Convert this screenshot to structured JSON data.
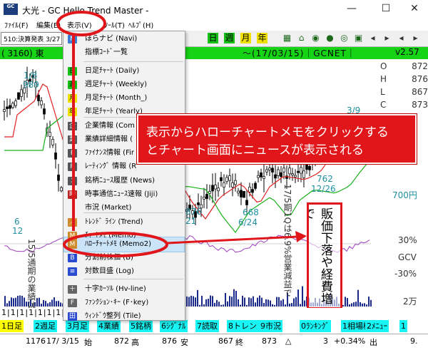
{
  "window": {
    "logo": "GC",
    "title": "大光 - GC Hello Trend Master -",
    "controls": {
      "minimize": "—",
      "maximize": "☐",
      "close": "✕"
    }
  },
  "menubar": {
    "file": "ﾌｧｲﾙ(F)",
    "edit": "編集(E)",
    "view": "表示(V)",
    "tool": "ﾂｰﾙ(T)",
    "help": "ﾍﾙﾌﾟ(H)"
  },
  "toolbar": {
    "info_text": "510:決算発表 3/27",
    "buttons": [
      "日",
      "週",
      "月",
      "年"
    ]
  },
  "chart": {
    "code_label": "( 3160) 東",
    "period_label": "～(17/03/15)｜GCNET｜",
    "version": "v2.57",
    "ohlc": [
      {
        "k": "O",
        "v": "872"
      },
      {
        "k": "H",
        "v": "876"
      },
      {
        "k": "L",
        "v": "867"
      },
      {
        "k": "C",
        "v": "873"
      }
    ],
    "labels": {
      "l1_date": "1/8",
      "l1_val": "989",
      "l2_val": "6",
      "l2_date": "12",
      "l3_val": "876",
      "l3_date": "21",
      "l4_val": "668",
      "l4_date": "6/24",
      "l5_val": "762",
      "l5_date": "12/26",
      "l6_date": "3/9",
      "price_700": "700円",
      "osc_30": "30%",
      "osc_gcv": "GCV",
      "osc_m30": "-30%",
      "vol_2m": "2万"
    },
    "vtext_left": "15/5通期の業績は",
    "vtext_mid": "17/5期1Qは6.9%営業減益で",
    "vtext_box": "販価下落や経費増で"
  },
  "bottom": {
    "tabs_row": "1|1|1|1|1|1|1|1|1|1|1|1|1|1|1|1",
    "funckeys": [
      {
        "label": "1日足",
        "style": "yellow"
      },
      {
        "label": "2週足",
        "style": "cyan-bg"
      },
      {
        "label": "3月足",
        "style": "cyan-bg"
      },
      {
        "label": "4業績",
        "style": "cyan-bg"
      },
      {
        "label": "5銘柄",
        "style": "cyan-bg"
      },
      {
        "label": "6ｼｸﾞﾅﾙ",
        "style": "cyan-bg"
      },
      {
        "label": "7読取",
        "style": "cyan-bg"
      },
      {
        "label": "8トレンド",
        "style": "cyan-bg"
      },
      {
        "label": "9市況",
        "style": "cyan-bg"
      },
      {
        "label": "0ﾗﾝｷﾝｸﾞ",
        "style": "cyan-bg"
      },
      {
        "label": "1相場欄",
        "style": "cyan-bg"
      },
      {
        "label": "2ﾒﾆｭｰ",
        "style": "cyan-bg"
      },
      {
        "label": "1",
        "style": "cyan-bg"
      }
    ],
    "status": {
      "s1": "1176",
      "s2": "17/ 3/15",
      "s3": "始",
      "s4": "872",
      "s5": "高",
      "s6": "876",
      "s7": "安",
      "s8": "867",
      "s9": "終",
      "s10": "873",
      "s11": "△",
      "s12": "3",
      "s13": "+0.34%",
      "s14": "出",
      "s15": "9."
    }
  },
  "dropdown": {
    "items": [
      {
        "label": "ほらナビ (Navi)",
        "icon": "navi-icon",
        "glyph": "N",
        "bg": "#3a7bd5",
        "fg": "#fff"
      },
      {
        "label": "指標ｺｰﾄﾞ一覧",
        "icon": "list-icon",
        "glyph": "",
        "bg": "transparent",
        "fg": "#000"
      },
      {
        "label": "日足ﾁｬｰﾄ (Daily)",
        "icon": "daily-chart-icon",
        "glyph": "日",
        "bg": "#17c117",
        "fg": "#000"
      },
      {
        "label": "週足ﾁｬｰﾄ (Weekly)",
        "icon": "weekly-chart-icon",
        "glyph": "週",
        "bg": "#17c117",
        "fg": "#000"
      },
      {
        "label": "月足ﾁｬｰﾄ (Month_)",
        "icon": "monthly-chart-icon",
        "glyph": "月",
        "bg": "#f0e000",
        "fg": "#000"
      },
      {
        "label": "年足ﾁｬｰﾄ (Yearly)",
        "icon": "yearly-chart-icon",
        "glyph": "年",
        "bg": "#f0e000",
        "fg": "#000"
      },
      {
        "label": "企業情報 (Com",
        "icon": "company-icon",
        "glyph": "企",
        "bg": "#555",
        "fg": "#fff"
      },
      {
        "label": "業績詳細情報 (",
        "icon": "earnings-icon",
        "glyph": "業",
        "bg": "#555",
        "fg": "#fff"
      },
      {
        "label": "ﾌｧｲﾅﾝｽ情報 (Fir",
        "icon": "finance-icon",
        "glyph": "F",
        "bg": "#555",
        "fg": "#fff"
      },
      {
        "label": "ﾚｰﾃｨﾝｸﾞ 情報 (R",
        "icon": "rating-icon",
        "glyph": "R",
        "bg": "#555",
        "fg": "#fff"
      },
      {
        "label": "銘柄ﾆｭｰｽ履歴 (News)",
        "icon": "news-icon",
        "glyph": "ﾆ",
        "bg": "#555",
        "fg": "#fff"
      },
      {
        "label": "時事通信ﾆｭｰｽ速報 (Jiji)",
        "icon": "jiji-icon",
        "glyph": "時",
        "bg": "#b22",
        "fg": "#fff"
      },
      {
        "label": "市況 (Market)",
        "icon": "market-icon",
        "glyph": "",
        "bg": "transparent",
        "fg": "#000"
      },
      {
        "label": "ﾄﾚﾝﾄﾞ ﾗｲﾝ (Trend)",
        "icon": "trend-icon",
        "glyph": "／",
        "bg": "#d08a2a",
        "fg": "#fff"
      },
      {
        "label": "ﾁｬｰﾄﾒﾓ (Memo)",
        "icon": "memo-icon",
        "glyph": "M",
        "bg": "#d08a2a",
        "fg": "#fff"
      },
      {
        "label": "ﾊﾛｰﾁｬｰﾄﾒﾓ (Memo2)",
        "icon": "memo2-icon",
        "glyph": "M",
        "bg": "#d08a2a",
        "fg": "#fff"
      },
      {
        "label": "分割前株価 (B)",
        "icon": "split-icon",
        "glyph": "B",
        "bg": "#2a4bd0",
        "fg": "#fff"
      },
      {
        "label": "対数目盛 (Log)",
        "icon": "log-icon",
        "glyph": "≡",
        "bg": "#2a4bd0",
        "fg": "#fff"
      },
      {
        "label": "十字ｶｰｿﾙ (Hv-line)",
        "icon": "crosshair-icon",
        "glyph": "＋",
        "bg": "#666",
        "fg": "#fff"
      },
      {
        "label": "ﾌｧﾝｸｼｮﾝ･ｷｰ (F･key)",
        "icon": "fkey-icon",
        "glyph": "F",
        "bg": "#666",
        "fg": "#fff"
      },
      {
        "label": "ｳｨﾝﾄﾞｳ整列 (Tile)",
        "icon": "tile-icon",
        "glyph": "田",
        "bg": "#2a4bd0",
        "fg": "#fff"
      }
    ]
  },
  "callout": {
    "line1": "表示からハローチャートメモをクリックする",
    "line2": "とチャート画面にニュースが表示される"
  },
  "colors": {
    "header_band": "#16d316",
    "callout_red": "#e0161b",
    "highlight": "#cce4f7",
    "candle": "#000000",
    "ma_red": "#e02020",
    "ma_green": "#19b019",
    "osc": "#a040c0"
  }
}
